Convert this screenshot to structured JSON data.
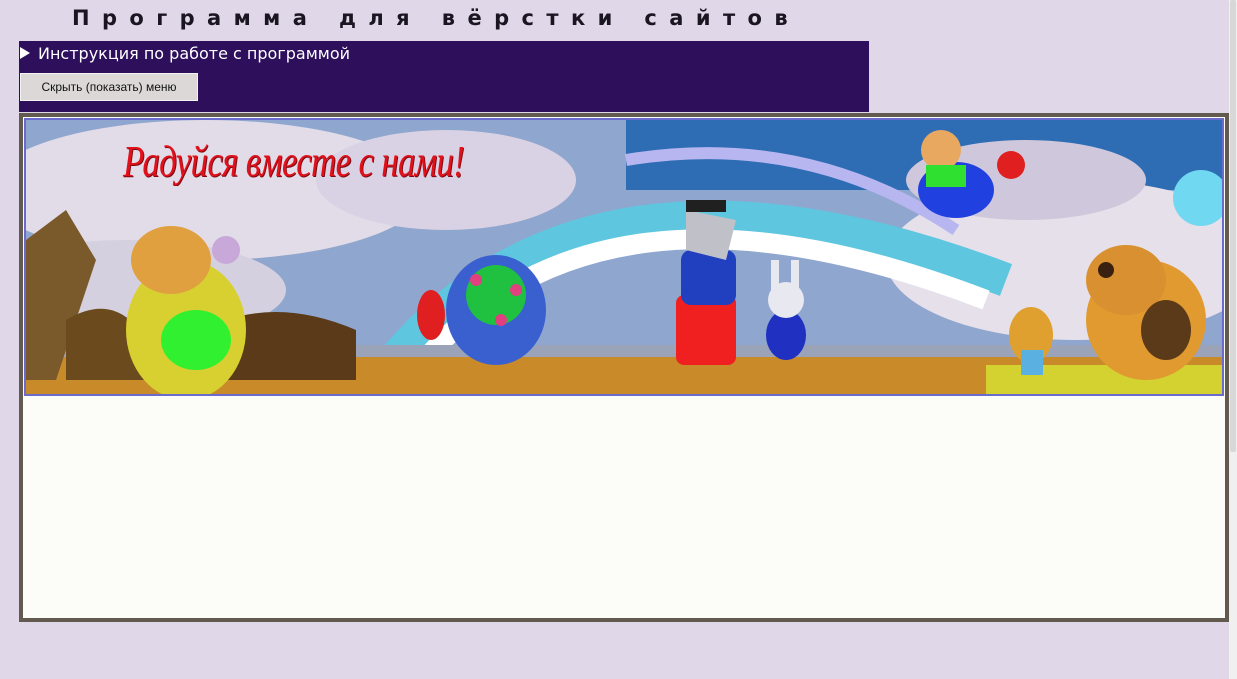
{
  "header": {
    "title": "Программа для вёрстки сайтов"
  },
  "menu": {
    "instructions_label": "Инструкция по работе с программой",
    "toggle_label": "Скрыть (показать) меню"
  },
  "banner": {
    "caption": "Радуйся вместе с нами!",
    "icon": "cartoon-banner-image"
  },
  "colors": {
    "page_bg": "#e0d8e8",
    "menu_bg": "#2d0f5c",
    "frame_border": "#625a4e",
    "caption_red": "#e0111a"
  }
}
